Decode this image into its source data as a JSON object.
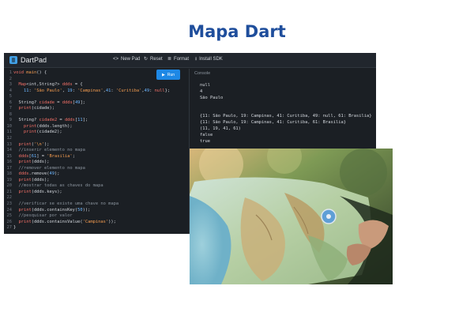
{
  "page": {
    "title": "Mapa Dart"
  },
  "app": {
    "name": "DartPad",
    "toolbar": [
      {
        "icon": "code-icon",
        "glyph": "<>",
        "label": "New Pad"
      },
      {
        "icon": "refresh-icon",
        "glyph": "↻",
        "label": "Reset"
      },
      {
        "icon": "format-icon",
        "glyph": "≣",
        "label": "Format"
      },
      {
        "icon": "download-icon",
        "glyph": "⭳",
        "label": "Install SDK"
      }
    ],
    "run_label": "Run",
    "console_label": "Console"
  },
  "code_lines": [
    [
      [
        "kw",
        "void "
      ],
      [
        "fn",
        "main"
      ],
      [
        "code",
        "() {"
      ]
    ],
    [
      [
        "code",
        ""
      ]
    ],
    [
      [
        "code",
        "  "
      ],
      [
        "kw",
        "Map"
      ],
      [
        "code",
        "<int,String?> "
      ],
      [
        "kw",
        "ddds"
      ],
      [
        "code",
        " = {"
      ]
    ],
    [
      [
        "code",
        "    "
      ],
      [
        "num",
        "11"
      ],
      [
        "code",
        ": "
      ],
      [
        "str",
        "'São Paulo'"
      ],
      [
        "code",
        ", "
      ],
      [
        "num",
        "19"
      ],
      [
        "code",
        ": "
      ],
      [
        "str",
        "'Campinas'"
      ],
      [
        "code",
        ","
      ],
      [
        "num",
        "41"
      ],
      [
        "code",
        ": "
      ],
      [
        "str",
        "'Curitiba'"
      ],
      [
        "code",
        ","
      ],
      [
        "num",
        "49"
      ],
      [
        "code",
        ": "
      ],
      [
        "kw",
        "null"
      ],
      [
        "code",
        "};"
      ]
    ],
    [
      [
        "code",
        ""
      ]
    ],
    [
      [
        "code",
        "  String? "
      ],
      [
        "kw",
        "cidade"
      ],
      [
        "code",
        " = "
      ],
      [
        "kw",
        "ddds"
      ],
      [
        "code",
        "["
      ],
      [
        "num",
        "49"
      ],
      [
        "code",
        "];"
      ]
    ],
    [
      [
        "code",
        "  "
      ],
      [
        "kw",
        "print"
      ],
      [
        "code",
        "(cidade);"
      ]
    ],
    [
      [
        "code",
        ""
      ]
    ],
    [
      [
        "code",
        "  String? "
      ],
      [
        "kw",
        "cidade2"
      ],
      [
        "code",
        " = "
      ],
      [
        "kw",
        "ddds"
      ],
      [
        "code",
        "["
      ],
      [
        "num",
        "11"
      ],
      [
        "code",
        "];"
      ]
    ],
    [
      [
        "code",
        "    "
      ],
      [
        "kw",
        "print"
      ],
      [
        "code",
        "(ddds.length);"
      ]
    ],
    [
      [
        "code",
        "    "
      ],
      [
        "kw",
        "print"
      ],
      [
        "code",
        "(cidade2);"
      ]
    ],
    [
      [
        "code",
        ""
      ]
    ],
    [
      [
        "code",
        "  "
      ],
      [
        "kw",
        "print"
      ],
      [
        "code",
        "("
      ],
      [
        "str",
        "'\\n'"
      ],
      [
        "code",
        ");"
      ]
    ],
    [
      [
        "cmt",
        "  //inserir elemento no mapa"
      ]
    ],
    [
      [
        "code",
        "  "
      ],
      [
        "kw",
        "ddds"
      ],
      [
        "code",
        "["
      ],
      [
        "num",
        "61"
      ],
      [
        "code",
        "] = "
      ],
      [
        "str",
        "'Brasilia'"
      ],
      [
        "code",
        ";"
      ]
    ],
    [
      [
        "code",
        "  "
      ],
      [
        "kw",
        "print"
      ],
      [
        "code",
        "(ddds);"
      ]
    ],
    [
      [
        "cmt",
        "  //remover elemento no mapa"
      ]
    ],
    [
      [
        "code",
        "  "
      ],
      [
        "kw",
        "ddds"
      ],
      [
        "code",
        ".remove("
      ],
      [
        "num",
        "49"
      ],
      [
        "code",
        ");"
      ]
    ],
    [
      [
        "code",
        "  "
      ],
      [
        "kw",
        "print"
      ],
      [
        "code",
        "(ddds);"
      ]
    ],
    [
      [
        "cmt",
        "  //mostrar todas as chaves do mapa"
      ]
    ],
    [
      [
        "code",
        "  "
      ],
      [
        "kw",
        "print"
      ],
      [
        "code",
        "(ddds.keys);"
      ]
    ],
    [
      [
        "code",
        ""
      ]
    ],
    [
      [
        "cmt",
        "  //verificar se existe uma chave no mapa"
      ]
    ],
    [
      [
        "code",
        "  "
      ],
      [
        "kw",
        "print"
      ],
      [
        "code",
        "(ddds.containsKey("
      ],
      [
        "num",
        "50"
      ],
      [
        "code",
        "));"
      ]
    ],
    [
      [
        "cmt",
        "  //pesquisar por valor"
      ]
    ],
    [
      [
        "code",
        "  "
      ],
      [
        "kw",
        "print"
      ],
      [
        "code",
        "(ddds.containsValue("
      ],
      [
        "str",
        "'Campinas'"
      ],
      [
        "code",
        "));"
      ]
    ],
    [
      [
        "code",
        "}"
      ]
    ]
  ],
  "console_output": [
    "null",
    "4",
    "São Paulo",
    "",
    "",
    "{11: São Paulo, 19: Campinas, 41: Curitiba, 49: null, 61: Brasilia}",
    "{11: São Paulo, 19: Campinas, 41: Curitiba, 61: Brasilia}",
    "(11, 19, 41, 61)",
    "false",
    "true"
  ],
  "colors": {
    "title": "#1f4e9c",
    "run_button": "#1e88e5",
    "editor_bg": "#1b1f24"
  }
}
